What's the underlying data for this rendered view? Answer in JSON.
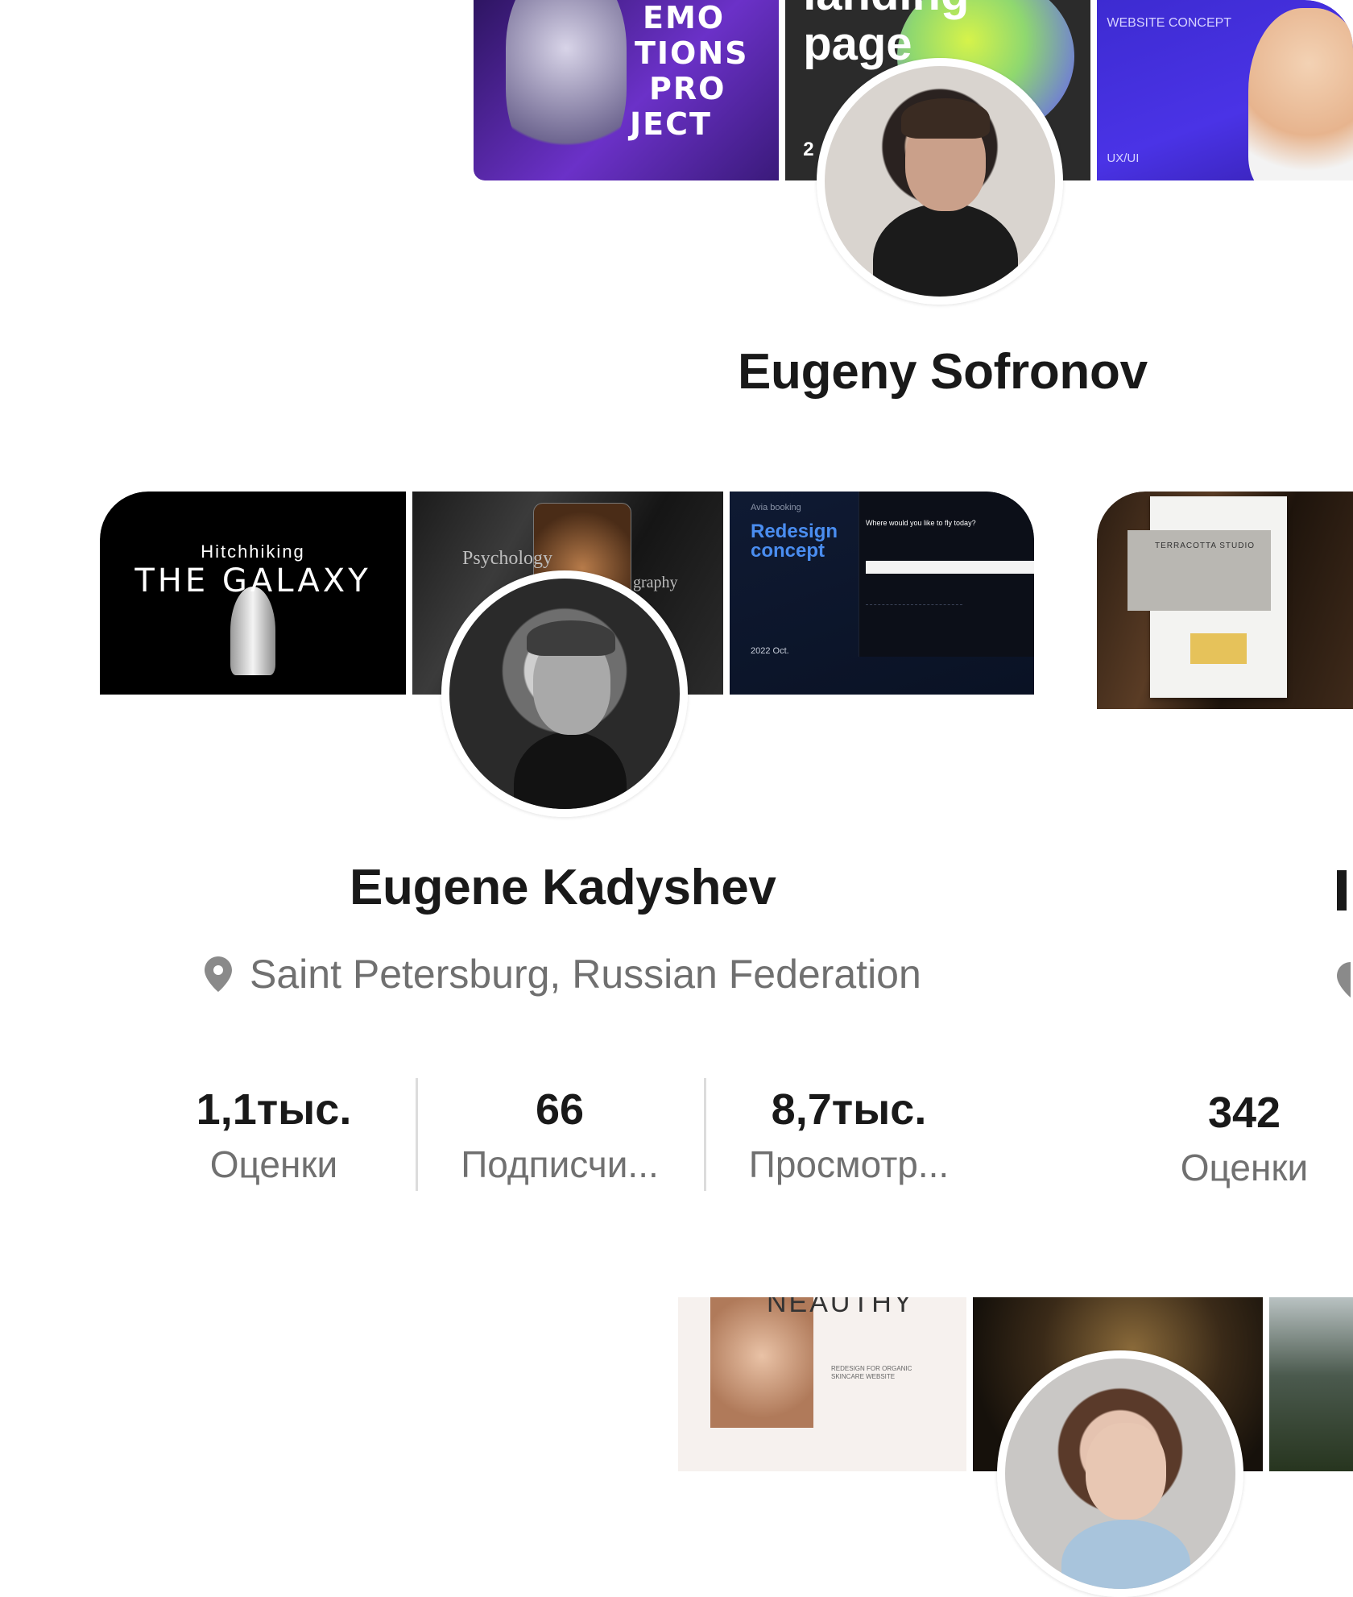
{
  "cards": [
    {
      "name": "Eugeny Sofronov",
      "projects": [
        {
          "title_lines": [
            "EMO",
            "TIONS",
            "PRO",
            "JECT"
          ]
        },
        {
          "title_lines": [
            "landing",
            "page"
          ],
          "extra": "2"
        },
        {
          "title": "WEBSITE CONCEPT",
          "subtitle": "UX/UI"
        }
      ]
    },
    {
      "name": "Eugene Kadyshev",
      "location": "Saint Petersburg, Russian Federation",
      "projects": [
        {
          "title_small": "Hitchhiking",
          "title_big": "THE GALAXY"
        },
        {
          "title": "Psychology",
          "title2": "graphy"
        },
        {
          "kicker": "Avia booking",
          "title_lines": [
            "Redesign",
            "concept"
          ],
          "date": "2022  Oct.",
          "screen_heading": "Where would you like to fly today?"
        }
      ],
      "stats": [
        {
          "value": "1,1тыс.",
          "label": "Оценки"
        },
        {
          "value": "66",
          "label": "Подписчи..."
        },
        {
          "value": "8,7тыс.",
          "label": "Просмотр..."
        }
      ]
    },
    {
      "projects": [
        {
          "title": "TERRACOTTA STUDIO"
        }
      ],
      "stats": [
        {
          "value": "342",
          "label": "Оценки"
        }
      ]
    },
    {
      "projects": [
        {
          "title": "NEAUTHY",
          "subtitle_lines": [
            "REDESIGN FOR ORGANIC",
            "SKINCARE WEBSITE"
          ]
        },
        {
          "title": ""
        },
        {
          "title": ""
        }
      ]
    }
  ]
}
